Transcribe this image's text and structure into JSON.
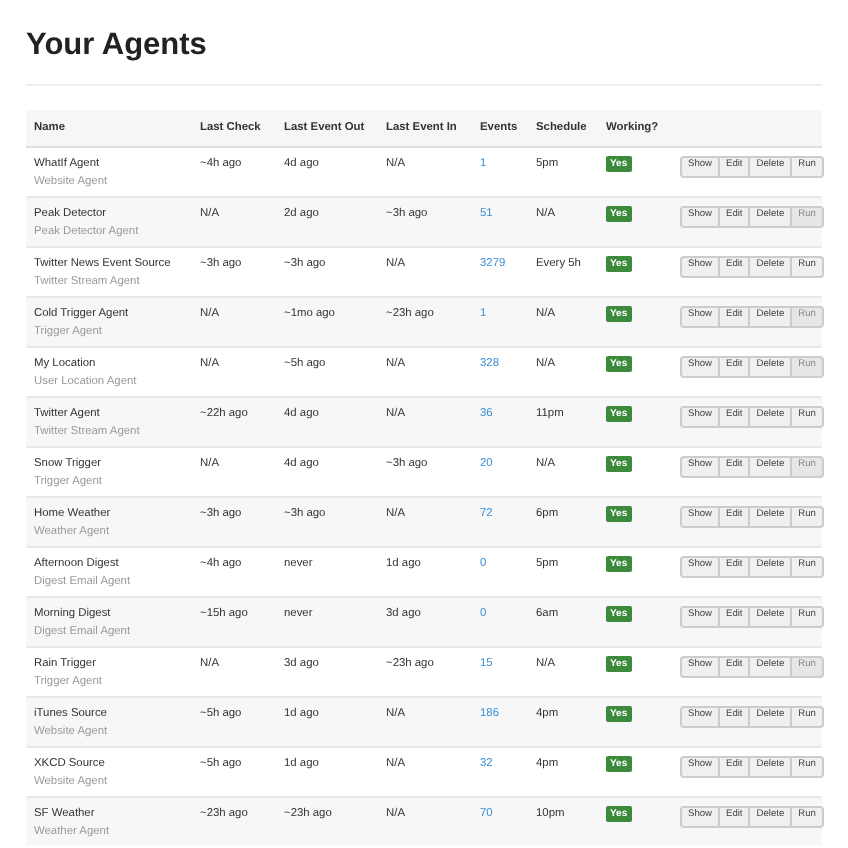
{
  "title": "Your Agents",
  "table": {
    "columns": [
      "Name",
      "Last Check",
      "Last Event Out",
      "Last Event In",
      "Events",
      "Schedule",
      "Working?"
    ],
    "rows": [
      {
        "name": "WhatIf Agent",
        "type": "Website Agent",
        "last_check": "~4h ago",
        "last_event_out": "4d ago",
        "last_event_in": "N/A",
        "events": "1",
        "schedule": "5pm",
        "working": "Yes",
        "actions": [
          "Show",
          "Edit",
          "Delete",
          "Run"
        ],
        "run_disabled": false
      },
      {
        "name": "Peak Detector",
        "type": "Peak Detector Agent",
        "last_check": "N/A",
        "last_event_out": "2d ago",
        "last_event_in": "~3h ago",
        "events": "51",
        "schedule": "N/A",
        "working": "Yes",
        "actions": [
          "Show",
          "Edit",
          "Delete",
          "Run"
        ],
        "run_disabled": true
      },
      {
        "name": "Twitter News Event Source",
        "type": "Twitter Stream Agent",
        "last_check": "~3h ago",
        "last_event_out": "~3h ago",
        "last_event_in": "N/A",
        "events": "3279",
        "schedule": "Every 5h",
        "working": "Yes",
        "actions": [
          "Show",
          "Edit",
          "Delete",
          "Run"
        ],
        "run_disabled": false
      },
      {
        "name": "Cold Trigger Agent",
        "type": "Trigger Agent",
        "last_check": "N/A",
        "last_event_out": "~1mo ago",
        "last_event_in": "~23h ago",
        "events": "1",
        "schedule": "N/A",
        "working": "Yes",
        "actions": [
          "Show",
          "Edit",
          "Delete",
          "Run"
        ],
        "run_disabled": true
      },
      {
        "name": "My Location",
        "type": "User Location Agent",
        "last_check": "N/A",
        "last_event_out": "~5h ago",
        "last_event_in": "N/A",
        "events": "328",
        "schedule": "N/A",
        "working": "Yes",
        "actions": [
          "Show",
          "Edit",
          "Delete",
          "Run"
        ],
        "run_disabled": true
      },
      {
        "name": "Twitter Agent",
        "type": "Twitter Stream Agent",
        "last_check": "~22h ago",
        "last_event_out": "4d ago",
        "last_event_in": "N/A",
        "events": "36",
        "schedule": "11pm",
        "working": "Yes",
        "actions": [
          "Show",
          "Edit",
          "Delete",
          "Run"
        ],
        "run_disabled": false
      },
      {
        "name": "Snow Trigger",
        "type": "Trigger Agent",
        "last_check": "N/A",
        "last_event_out": "4d ago",
        "last_event_in": "~3h ago",
        "events": "20",
        "schedule": "N/A",
        "working": "Yes",
        "actions": [
          "Show",
          "Edit",
          "Delete",
          "Run"
        ],
        "run_disabled": true
      },
      {
        "name": "Home Weather",
        "type": "Weather Agent",
        "last_check": "~3h ago",
        "last_event_out": "~3h ago",
        "last_event_in": "N/A",
        "events": "72",
        "schedule": "6pm",
        "working": "Yes",
        "actions": [
          "Show",
          "Edit",
          "Delete",
          "Run"
        ],
        "run_disabled": false
      },
      {
        "name": "Afternoon Digest",
        "type": "Digest Email Agent",
        "last_check": "~4h ago",
        "last_event_out": "never",
        "last_event_in": "1d ago",
        "events": "0",
        "schedule": "5pm",
        "working": "Yes",
        "actions": [
          "Show",
          "Edit",
          "Delete",
          "Run"
        ],
        "run_disabled": false
      },
      {
        "name": "Morning Digest",
        "type": "Digest Email Agent",
        "last_check": "~15h ago",
        "last_event_out": "never",
        "last_event_in": "3d ago",
        "events": "0",
        "schedule": "6am",
        "working": "Yes",
        "actions": [
          "Show",
          "Edit",
          "Delete",
          "Run"
        ],
        "run_disabled": false
      },
      {
        "name": "Rain Trigger",
        "type": "Trigger Agent",
        "last_check": "N/A",
        "last_event_out": "3d ago",
        "last_event_in": "~23h ago",
        "events": "15",
        "schedule": "N/A",
        "working": "Yes",
        "actions": [
          "Show",
          "Edit",
          "Delete",
          "Run"
        ],
        "run_disabled": true
      },
      {
        "name": "iTunes Source",
        "type": "Website Agent",
        "last_check": "~5h ago",
        "last_event_out": "1d ago",
        "last_event_in": "N/A",
        "events": "186",
        "schedule": "4pm",
        "working": "Yes",
        "actions": [
          "Show",
          "Edit",
          "Delete",
          "Run"
        ],
        "run_disabled": false
      },
      {
        "name": "XKCD Source",
        "type": "Website Agent",
        "last_check": "~5h ago",
        "last_event_out": "1d ago",
        "last_event_in": "N/A",
        "events": "32",
        "schedule": "4pm",
        "working": "Yes",
        "actions": [
          "Show",
          "Edit",
          "Delete",
          "Run"
        ],
        "run_disabled": false
      },
      {
        "name": "SF Weather",
        "type": "Weather Agent",
        "last_check": "~23h ago",
        "last_event_out": "~23h ago",
        "last_event_in": "N/A",
        "events": "70",
        "schedule": "10pm",
        "working": "Yes",
        "actions": [
          "Show",
          "Edit",
          "Delete",
          "Run"
        ],
        "run_disabled": false
      }
    ]
  }
}
